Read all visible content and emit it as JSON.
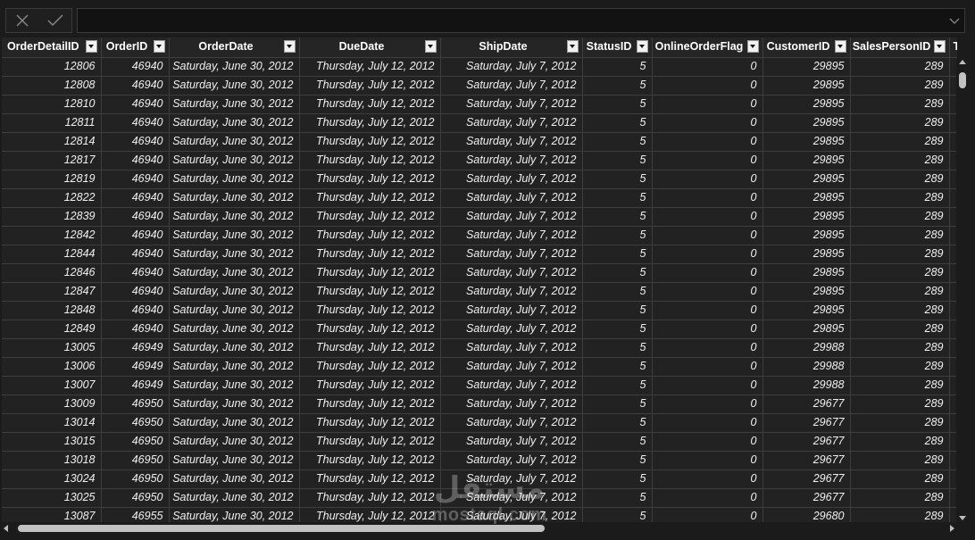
{
  "formula_bar": {
    "value": ""
  },
  "columns": [
    {
      "key": "OrderDetailID",
      "label": "OrderDetailID"
    },
    {
      "key": "OrderID",
      "label": "OrderID"
    },
    {
      "key": "OrderDate",
      "label": "OrderDate"
    },
    {
      "key": "DueDate",
      "label": "DueDate"
    },
    {
      "key": "ShipDate",
      "label": "ShipDate"
    },
    {
      "key": "StatusID",
      "label": "StatusID"
    },
    {
      "key": "OnlineOrderFlag",
      "label": "OnlineOrderFlag"
    },
    {
      "key": "CustomerID",
      "label": "CustomerID"
    },
    {
      "key": "SalesPersonID",
      "label": "SalesPersonID"
    },
    {
      "key": "Ter",
      "label": "Ter"
    }
  ],
  "rows": [
    [
      "12806",
      "46940",
      "Saturday, June 30, 2012",
      "Thursday, July 12, 2012",
      "Saturday, July 7, 2012",
      "5",
      "0",
      "29895",
      "289",
      ""
    ],
    [
      "12808",
      "46940",
      "Saturday, June 30, 2012",
      "Thursday, July 12, 2012",
      "Saturday, July 7, 2012",
      "5",
      "0",
      "29895",
      "289",
      ""
    ],
    [
      "12810",
      "46940",
      "Saturday, June 30, 2012",
      "Thursday, July 12, 2012",
      "Saturday, July 7, 2012",
      "5",
      "0",
      "29895",
      "289",
      ""
    ],
    [
      "12811",
      "46940",
      "Saturday, June 30, 2012",
      "Thursday, July 12, 2012",
      "Saturday, July 7, 2012",
      "5",
      "0",
      "29895",
      "289",
      ""
    ],
    [
      "12814",
      "46940",
      "Saturday, June 30, 2012",
      "Thursday, July 12, 2012",
      "Saturday, July 7, 2012",
      "5",
      "0",
      "29895",
      "289",
      ""
    ],
    [
      "12817",
      "46940",
      "Saturday, June 30, 2012",
      "Thursday, July 12, 2012",
      "Saturday, July 7, 2012",
      "5",
      "0",
      "29895",
      "289",
      ""
    ],
    [
      "12819",
      "46940",
      "Saturday, June 30, 2012",
      "Thursday, July 12, 2012",
      "Saturday, July 7, 2012",
      "5",
      "0",
      "29895",
      "289",
      ""
    ],
    [
      "12822",
      "46940",
      "Saturday, June 30, 2012",
      "Thursday, July 12, 2012",
      "Saturday, July 7, 2012",
      "5",
      "0",
      "29895",
      "289",
      ""
    ],
    [
      "12839",
      "46940",
      "Saturday, June 30, 2012",
      "Thursday, July 12, 2012",
      "Saturday, July 7, 2012",
      "5",
      "0",
      "29895",
      "289",
      ""
    ],
    [
      "12842",
      "46940",
      "Saturday, June 30, 2012",
      "Thursday, July 12, 2012",
      "Saturday, July 7, 2012",
      "5",
      "0",
      "29895",
      "289",
      ""
    ],
    [
      "12844",
      "46940",
      "Saturday, June 30, 2012",
      "Thursday, July 12, 2012",
      "Saturday, July 7, 2012",
      "5",
      "0",
      "29895",
      "289",
      ""
    ],
    [
      "12846",
      "46940",
      "Saturday, June 30, 2012",
      "Thursday, July 12, 2012",
      "Saturday, July 7, 2012",
      "5",
      "0",
      "29895",
      "289",
      ""
    ],
    [
      "12847",
      "46940",
      "Saturday, June 30, 2012",
      "Thursday, July 12, 2012",
      "Saturday, July 7, 2012",
      "5",
      "0",
      "29895",
      "289",
      ""
    ],
    [
      "12848",
      "46940",
      "Saturday, June 30, 2012",
      "Thursday, July 12, 2012",
      "Saturday, July 7, 2012",
      "5",
      "0",
      "29895",
      "289",
      ""
    ],
    [
      "12849",
      "46940",
      "Saturday, June 30, 2012",
      "Thursday, July 12, 2012",
      "Saturday, July 7, 2012",
      "5",
      "0",
      "29895",
      "289",
      ""
    ],
    [
      "13005",
      "46949",
      "Saturday, June 30, 2012",
      "Thursday, July 12, 2012",
      "Saturday, July 7, 2012",
      "5",
      "0",
      "29988",
      "289",
      ""
    ],
    [
      "13006",
      "46949",
      "Saturday, June 30, 2012",
      "Thursday, July 12, 2012",
      "Saturday, July 7, 2012",
      "5",
      "0",
      "29988",
      "289",
      ""
    ],
    [
      "13007",
      "46949",
      "Saturday, June 30, 2012",
      "Thursday, July 12, 2012",
      "Saturday, July 7, 2012",
      "5",
      "0",
      "29988",
      "289",
      ""
    ],
    [
      "13009",
      "46950",
      "Saturday, June 30, 2012",
      "Thursday, July 12, 2012",
      "Saturday, July 7, 2012",
      "5",
      "0",
      "29677",
      "289",
      ""
    ],
    [
      "13014",
      "46950",
      "Saturday, June 30, 2012",
      "Thursday, July 12, 2012",
      "Saturday, July 7, 2012",
      "5",
      "0",
      "29677",
      "289",
      ""
    ],
    [
      "13015",
      "46950",
      "Saturday, June 30, 2012",
      "Thursday, July 12, 2012",
      "Saturday, July 7, 2012",
      "5",
      "0",
      "29677",
      "289",
      ""
    ],
    [
      "13018",
      "46950",
      "Saturday, June 30, 2012",
      "Thursday, July 12, 2012",
      "Saturday, July 7, 2012",
      "5",
      "0",
      "29677",
      "289",
      ""
    ],
    [
      "13024",
      "46950",
      "Saturday, June 30, 2012",
      "Thursday, July 12, 2012",
      "Saturday, July 7, 2012",
      "5",
      "0",
      "29677",
      "289",
      ""
    ],
    [
      "13025",
      "46950",
      "Saturday, June 30, 2012",
      "Thursday, July 12, 2012",
      "Saturday, July 7, 2012",
      "5",
      "0",
      "29677",
      "289",
      ""
    ],
    [
      "13087",
      "46955",
      "Saturday, June 30, 2012",
      "Thursday, July 12, 2012",
      "Saturday, July 7, 2012",
      "5",
      "0",
      "29680",
      "289",
      ""
    ]
  ],
  "watermark": {
    "arabic": "مستقل",
    "latin": "mostaql.com"
  },
  "icons": {
    "cancel": "close-icon",
    "commit": "check-icon",
    "expand": "chevron-down-icon",
    "filter": "dropdown-arrow-icon"
  }
}
